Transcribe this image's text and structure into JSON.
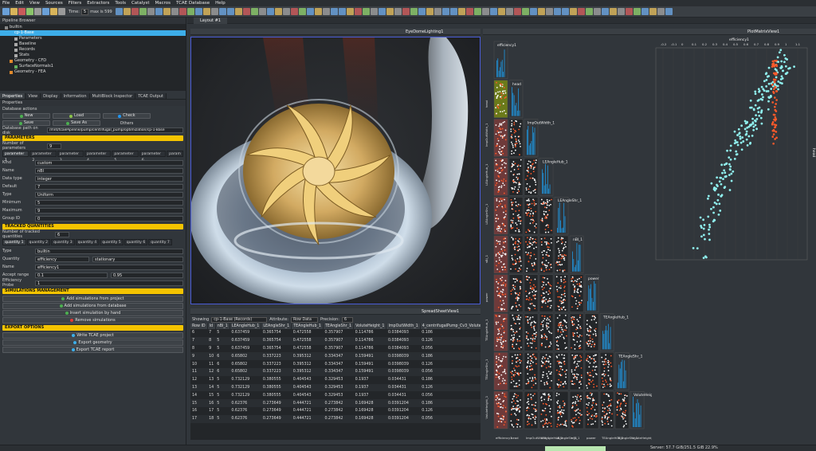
{
  "menu": [
    "File",
    "Edit",
    "View",
    "Sources",
    "Filters",
    "Extractors",
    "Tools",
    "Catalyst",
    "Macros",
    "TCAE Database",
    "Help"
  ],
  "time": {
    "label": "Time:",
    "value": "5",
    "max_label": "max is 599"
  },
  "pipeline": {
    "title": "Pipeline Browser",
    "items": [
      {
        "label": "builtin",
        "indent": 1,
        "selected": false,
        "color": "#888888"
      },
      {
        "label": "cp-1-Base",
        "indent": 2,
        "selected": true,
        "color": "#3daee9"
      },
      {
        "label": "Parameters",
        "indent": 3,
        "selected": false,
        "color": "#aaaaaa"
      },
      {
        "label": "Baseline",
        "indent": 3,
        "selected": false,
        "color": "#aaaaaa"
      },
      {
        "label": "Records",
        "indent": 3,
        "selected": false,
        "color": "#aaaaaa"
      },
      {
        "label": "Stats",
        "indent": 3,
        "selected": false,
        "color": "#aaaaaa"
      },
      {
        "label": "Geometry - CFD",
        "indent": 2,
        "selected": false,
        "color": "#e08a2c"
      },
      {
        "label": "SurfaceNormals1",
        "indent": 3,
        "selected": false,
        "color": "#60b060"
      },
      {
        "label": "Geometry - FEA",
        "indent": 2,
        "selected": false,
        "color": "#e08a2c"
      }
    ]
  },
  "panel_tabs": [
    "Properties",
    "View",
    "Display",
    "Information",
    "MultiBlock Inspector",
    "TCAE Output"
  ],
  "properties_title": "Properties",
  "database_actions": {
    "title": "Database actions",
    "new": "New",
    "load": "Load",
    "check": "Check",
    "save": "Save",
    "save_as": "Save As",
    "others": "Others",
    "path_label": "Database path on disk",
    "path_value": "/mnt/tcaePipeline/pump/centrifugal_pump/optimization/cp-1-Base"
  },
  "parameters": {
    "section": "PARAMETERS",
    "count_label": "Number of parameters",
    "count_value": "9",
    "tabs": [
      "parameter 1",
      "parameter 2",
      "parameter 3",
      "parameter 4",
      "parameter 5",
      "parameter 6",
      "param"
    ],
    "fields": [
      {
        "label": "Kind",
        "value": "custom"
      },
      {
        "label": "Name",
        "value": "nBl"
      },
      {
        "label": "Data type",
        "value": "integer"
      },
      {
        "label": "Default",
        "value": "7"
      },
      {
        "label": "Type",
        "value": "Uniform"
      },
      {
        "label": "Minimum",
        "value": "5"
      },
      {
        "label": "Maximum",
        "value": "9"
      },
      {
        "label": "Group ID",
        "value": "0"
      }
    ]
  },
  "tracked": {
    "section": "TRACKED QUANTITIES",
    "count_label": "Number of tracked quantities",
    "count_value": "6",
    "tabs": [
      "quantity 1",
      "quantity 2",
      "quantity 3",
      "quantity 4",
      "quantity 5",
      "quantity 6",
      "quantity 7"
    ],
    "type_label": "Type",
    "type_value": "builtin",
    "quantity_label": "Quantity",
    "quantity_value": "efficiency",
    "quantity_extra": "stationary",
    "name_label": "Name",
    "name_value": "efficiency1",
    "accept_label": "Accept range",
    "accept_min": "0.1",
    "accept_max": "0.95",
    "probe_label": "Efficiency Probe",
    "probe_value": "1"
  },
  "simulations": {
    "section": "SIMULATIONS MANAGEMENT",
    "buttons": [
      "Add simulations from project",
      "Add simulations from database",
      "Insert simulation by hand",
      "Remove simulations"
    ]
  },
  "export": {
    "section": "EXPORT OPTIONS",
    "buttons": [
      "Write TCAE project",
      "Export geometry",
      "Export TCAE report"
    ]
  },
  "layout_tab": "Layout #1",
  "render_view_label": "EyeDomeLighting1",
  "plot_matrix_label": "PlotMatrixView1",
  "spreadsheet": {
    "title": "SpreadSheetView1",
    "showing_label": "Showing",
    "showing_value": "cp-1-Base (Records)",
    "attribute_label": "Attribute:",
    "attribute_value": "Row Data",
    "precision_label": "Precision:",
    "precision_value": "6",
    "columns": [
      "Row ID",
      "Id",
      "nBl_1",
      "LEAngleHub_1",
      "LEAngleShr_1",
      "TEAngleHub_1",
      "TEAngleShr_1",
      "VoluteHeight_1",
      "ImpOutWidth_1",
      "4_centrifugalPump_Cv3_VoluteEx"
    ],
    "rows": [
      [
        "6",
        "7",
        "5",
        "0.637459",
        "0.365754",
        "0.472558",
        "0.357907",
        "0.114786",
        "0.0384093",
        "0.186"
      ],
      [
        "7",
        "8",
        "5",
        "0.637459",
        "0.365754",
        "0.472558",
        "0.357907",
        "0.114786",
        "0.0384093",
        "0.126"
      ],
      [
        "8",
        "9",
        "5",
        "0.637459",
        "0.365754",
        "0.472558",
        "0.357907",
        "0.114786",
        "0.0384093",
        "0.056"
      ],
      [
        "9",
        "10",
        "6",
        "0.65802",
        "0.337223",
        "0.395312",
        "0.334347",
        "0.159491",
        "0.0398039",
        "0.186"
      ],
      [
        "10",
        "11",
        "6",
        "0.65802",
        "0.337223",
        "0.395312",
        "0.334347",
        "0.159491",
        "0.0398039",
        "0.126"
      ],
      [
        "11",
        "12",
        "6",
        "0.65802",
        "0.337223",
        "0.395312",
        "0.334347",
        "0.159491",
        "0.0398039",
        "0.056"
      ],
      [
        "12",
        "13",
        "5",
        "0.732129",
        "0.380555",
        "0.404543",
        "0.329453",
        "0.1937",
        "0.034431",
        "0.186"
      ],
      [
        "13",
        "14",
        "5",
        "0.732129",
        "0.380555",
        "0.404543",
        "0.329453",
        "0.1937",
        "0.034431",
        "0.126"
      ],
      [
        "14",
        "15",
        "5",
        "0.732129",
        "0.380555",
        "0.404543",
        "0.329453",
        "0.1937",
        "0.034431",
        "0.056"
      ],
      [
        "15",
        "16",
        "5",
        "0.62376",
        "0.273649",
        "0.444721",
        "0.273842",
        "0.169428",
        "0.0391204",
        "0.186"
      ],
      [
        "16",
        "17",
        "5",
        "0.62376",
        "0.273649",
        "0.444721",
        "0.273842",
        "0.169428",
        "0.0391204",
        "0.126"
      ],
      [
        "17",
        "18",
        "5",
        "0.62376",
        "0.273649",
        "0.444721",
        "0.273842",
        "0.169428",
        "0.0391204",
        "0.056"
      ]
    ]
  },
  "matrix": {
    "variables": [
      "efficiency1",
      "head",
      "ImpOutWidth_1",
      "LEAngleHub_1",
      "LEAngleShr_1",
      "nBl_1",
      "power",
      "TEAngleHub_1",
      "TEAngleShr_1",
      "VoluteHeight_1"
    ],
    "histogram_ticks": [
      "200",
      "100"
    ]
  },
  "big_plot": {
    "x_label": "efficiency1",
    "y_label": "head",
    "x_ticks": [
      "-0.2",
      "-0.1",
      "0",
      "0.1",
      "0.2",
      "0.3",
      "0.4",
      "0.5",
      "0.6",
      "0.7",
      "0.8",
      "0.9",
      "1",
      "1.1"
    ]
  },
  "status": {
    "memory": "Server: 57.7 GiB/251.5 GiB 22.9%"
  }
}
